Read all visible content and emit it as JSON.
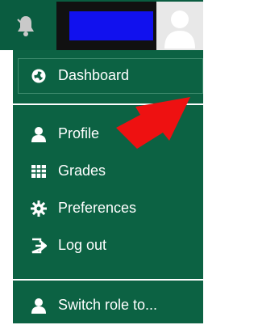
{
  "header": {
    "notification_icon": "bell-icon",
    "avatar_icon": "user-avatar-icon"
  },
  "menu": {
    "items": [
      {
        "label": "Dashboard",
        "icon": "dashboard-icon"
      },
      {
        "label": "Profile",
        "icon": "user-icon"
      },
      {
        "label": "Grades",
        "icon": "grades-icon"
      },
      {
        "label": "Preferences",
        "icon": "gear-icon"
      },
      {
        "label": "Log out",
        "icon": "logout-icon"
      },
      {
        "label": "Switch role to...",
        "icon": "user-icon"
      }
    ]
  },
  "annotation": {
    "arrow_color": "#ee1111"
  },
  "colors": {
    "menu_bg": "#0c6243",
    "header_bg": "#0a5c40",
    "text": "#ffffff"
  }
}
